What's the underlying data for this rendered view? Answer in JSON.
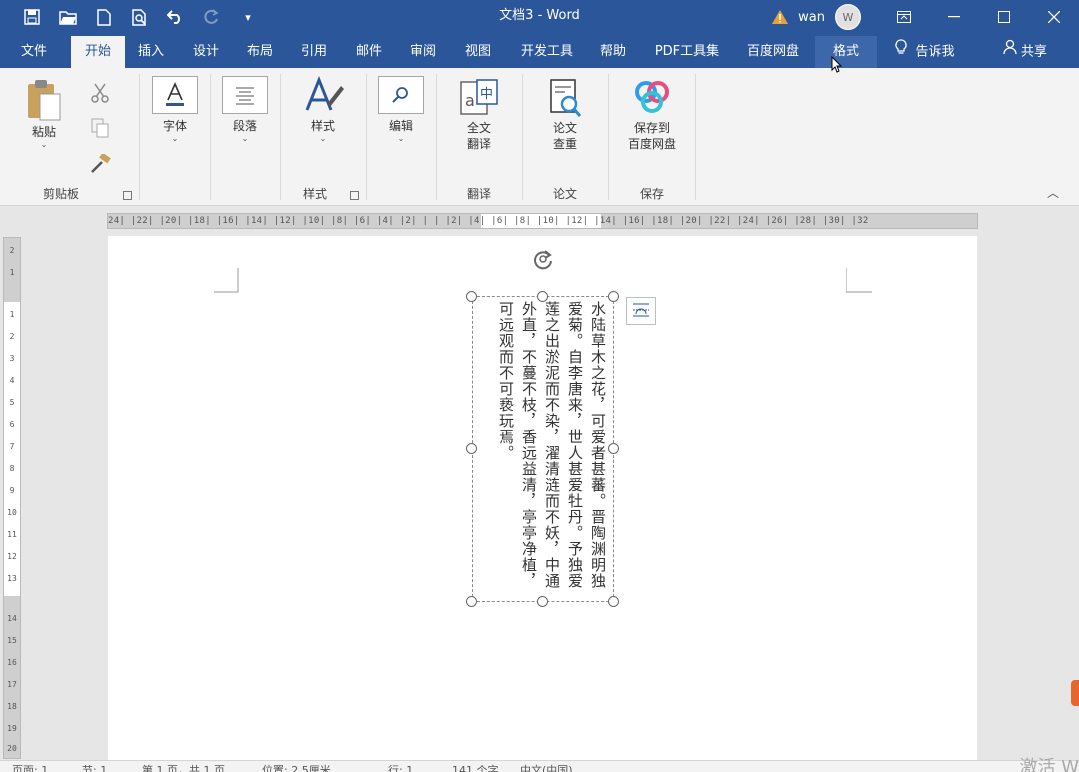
{
  "window": {
    "title": "文档3 - Word",
    "user": "wan",
    "avatar_initial": "W"
  },
  "qat": {
    "save": "save-icon",
    "open": "open-icon",
    "new": "new-doc-icon",
    "print_preview": "print-preview-icon",
    "undo": "undo-icon",
    "redo": "redo-icon",
    "customize": "customize-icon"
  },
  "tabs": [
    {
      "label": "文件"
    },
    {
      "label": "开始"
    },
    {
      "label": "插入"
    },
    {
      "label": "设计"
    },
    {
      "label": "布局"
    },
    {
      "label": "引用"
    },
    {
      "label": "邮件"
    },
    {
      "label": "审阅"
    },
    {
      "label": "视图"
    },
    {
      "label": "开发工具"
    },
    {
      "label": "帮助"
    },
    {
      "label": "PDF工具集"
    },
    {
      "label": "百度网盘"
    },
    {
      "label": "格式"
    },
    {
      "label": "告诉我"
    },
    {
      "label": "共享"
    }
  ],
  "ribbon": {
    "clipboard": {
      "paste": "粘贴",
      "group": "剪贴板"
    },
    "font": {
      "label": "字体"
    },
    "paragraph": {
      "label": "段落"
    },
    "styles": {
      "label": "样式",
      "group": "样式"
    },
    "editing": {
      "label": "编辑"
    },
    "translate": {
      "label_line1": "全文",
      "label_line2": "翻译",
      "group": "翻译"
    },
    "paper": {
      "label_line1": "论文",
      "label_line2": "查重",
      "group": "论文"
    },
    "save": {
      "label_line1": "保存到",
      "label_line2": "百度网盘",
      "group": "保存"
    }
  },
  "ruler": {
    "horizontal": "24| |22| |20| |18| |16| |14| |12| |10| |8| |6| |4| |2| | | |2| |4| |6| |8| |10| |12| |14| |16| |18| |20| |22| |24| |26| |28| |30| |32",
    "vertical": [
      "2",
      "1",
      "",
      "1",
      "2",
      "3",
      "4",
      "5",
      "6",
      "7",
      "8",
      "9",
      "10",
      "11",
      "12",
      "13",
      "14",
      "15",
      "16",
      "17",
      "18",
      "19",
      "20"
    ]
  },
  "document": {
    "text": "水陆草木之花，可爱者甚蕃。晋陶渊明独爱菊。自李唐来，世人甚爱牡丹。予独爱莲之出淤泥而不染，濯清涟而不妖，中通外直，不蔓不枝，香远益清，亭亭净植，可远观而不可亵玩焉。"
  },
  "statusbar": {
    "page": "页面: 1",
    "section": "节: 1",
    "page_of": "第 1 页，共 1 页",
    "position": "位置: 2.5厘米",
    "row": "行: 1",
    "words": "141 个字",
    "lang": "中文(中国)"
  },
  "watermark": "激活 W",
  "colors": {
    "brand": "#2b579a",
    "ribbon_bg": "#f3f3f3",
    "warning": "#e8a23a"
  }
}
